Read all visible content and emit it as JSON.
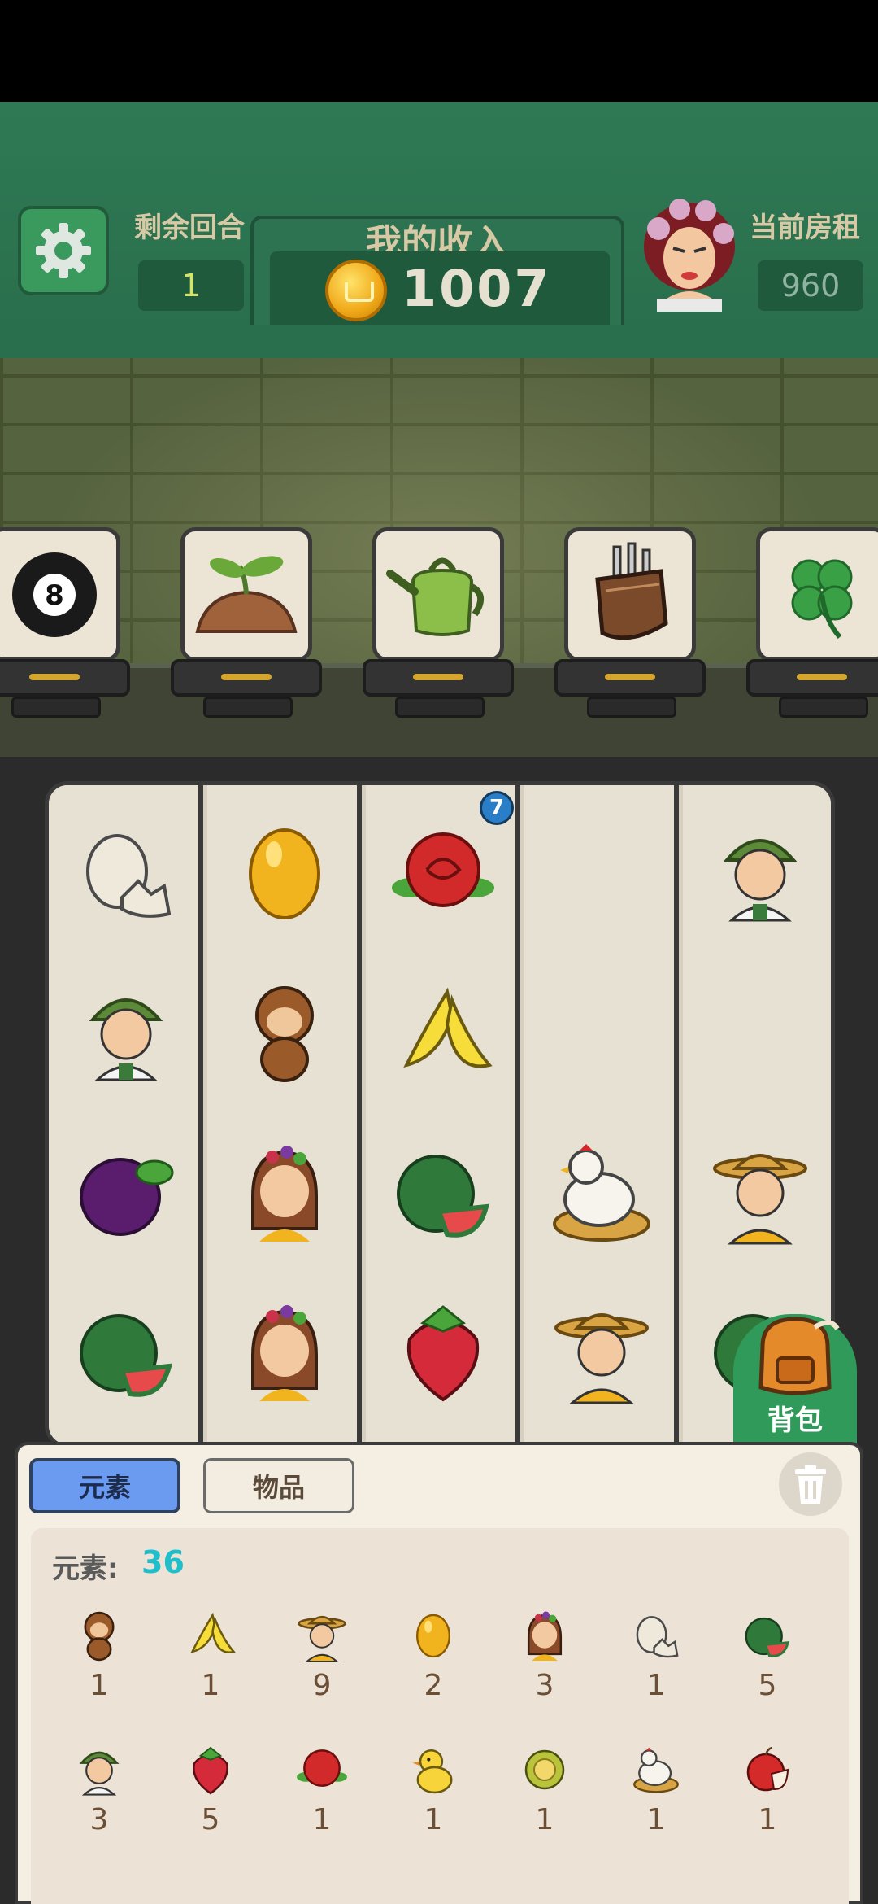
{
  "header": {
    "rounds_label": "剩余回合",
    "rounds_value": "1",
    "income_title": "我的收入",
    "income_value": "1007",
    "rent_label": "当前房租",
    "rent_value": "960"
  },
  "shelf_items": [
    "billiard-ball-8",
    "sprouting-soil",
    "watering-can",
    "tool-pouch",
    "four-leaf-clover"
  ],
  "board": {
    "columns": [
      [
        "cracked-egg",
        "farmer-girl",
        "plum",
        "watermelon"
      ],
      [
        "golden-egg",
        "monkey",
        "fruit-girl",
        "fruit-girl"
      ],
      [
        "rose",
        "banana",
        "watermelon",
        "strawberry"
      ],
      [
        "empty",
        "empty",
        "hen-on-nest",
        "farmer-man"
      ],
      [
        "farmer-girl",
        "empty",
        "farmer-man",
        "watermelon"
      ]
    ],
    "rose_badge": "7"
  },
  "bag_label": "背包",
  "inventory": {
    "tab_elements": "元素",
    "tab_items": "物品",
    "count_label": "元素:",
    "count_value": "36",
    "items": [
      {
        "icon": "monkey",
        "qty": "1"
      },
      {
        "icon": "banana",
        "qty": "1"
      },
      {
        "icon": "farmer-man",
        "qty": "9"
      },
      {
        "icon": "golden-egg",
        "qty": "2"
      },
      {
        "icon": "fruit-girl",
        "qty": "3"
      },
      {
        "icon": "cracked-egg",
        "qty": "1"
      },
      {
        "icon": "watermelon",
        "qty": "5"
      },
      {
        "icon": "farmer-girl",
        "qty": "3"
      },
      {
        "icon": "strawberry",
        "qty": "5"
      },
      {
        "icon": "rose",
        "qty": "1"
      },
      {
        "icon": "chick",
        "qty": "1"
      },
      {
        "icon": "durian",
        "qty": "1"
      },
      {
        "icon": "hen-on-nest",
        "qty": "1"
      },
      {
        "icon": "apple",
        "qty": "1"
      }
    ]
  },
  "colors": {
    "header_green": "#2f7a55",
    "accent_blue": "#6a9bf0",
    "count_cyan": "#1fbecb"
  }
}
